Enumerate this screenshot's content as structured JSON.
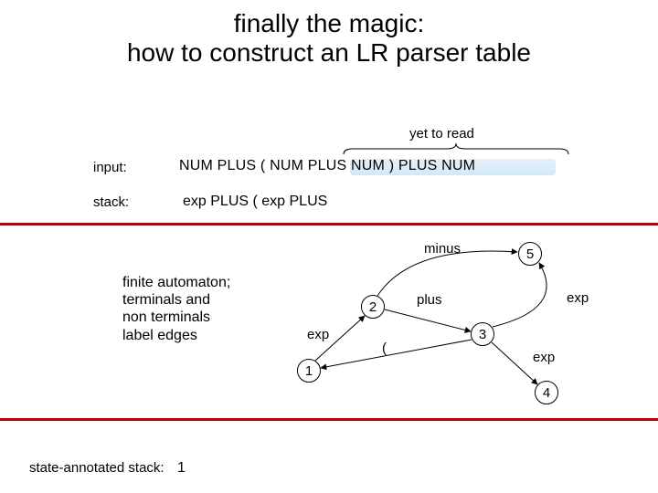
{
  "title_line1": "finally the magic:",
  "title_line2": "how to construct an LR parser table",
  "yet_to_read": "yet to read",
  "input_label": "input:",
  "input_value": "NUM PLUS ( NUM  PLUS NUM ) PLUS NUM",
  "stack_label": "stack:",
  "stack_value": "exp PLUS ( exp PLUS",
  "automaton_note_l1": "finite automaton;",
  "automaton_note_l2": "terminals and",
  "automaton_note_l3": "non terminals",
  "automaton_note_l4": "label edges",
  "state_ann_label": "state-annotated stack:",
  "state_ann_value": "1",
  "nodes": {
    "n1": "1",
    "n2": "2",
    "n3": "3",
    "n4": "4",
    "n5": "5"
  },
  "edge_labels": {
    "minus": "minus",
    "plus": "plus",
    "exp_12": "exp",
    "lparen": "(",
    "exp_34": "exp",
    "exp_35": "exp"
  }
}
